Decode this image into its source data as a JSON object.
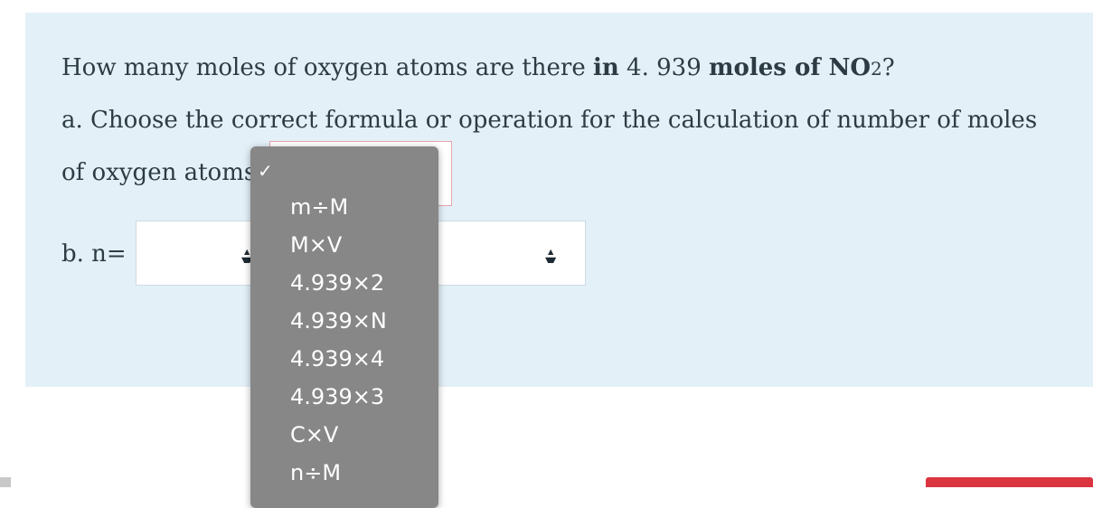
{
  "question": {
    "line1": {
      "part1": "How many moles of oxygen atoms are there ",
      "bold1": "in",
      "part2": " 4. 939 ",
      "bold2": "moles of  NO",
      "bold3": "2",
      "part3": "?"
    },
    "a_line1": "a. Choose the correct formula or operation for the calculation of number of moles",
    "a_line2": "of oxygen atoms",
    "b_label": "b.  n="
  },
  "dropdown": {
    "checkmark": "✓",
    "options": [
      "m÷M",
      "M×V",
      "4.939×2",
      "4.939×N",
      "4.939×4",
      "4.939×3",
      "C×V",
      "n÷M"
    ]
  },
  "colors": {
    "panel": "#e3f0f7",
    "dropdown": "#878787",
    "invalid_border": "#e8a4ae",
    "submit": "#d9343f"
  }
}
